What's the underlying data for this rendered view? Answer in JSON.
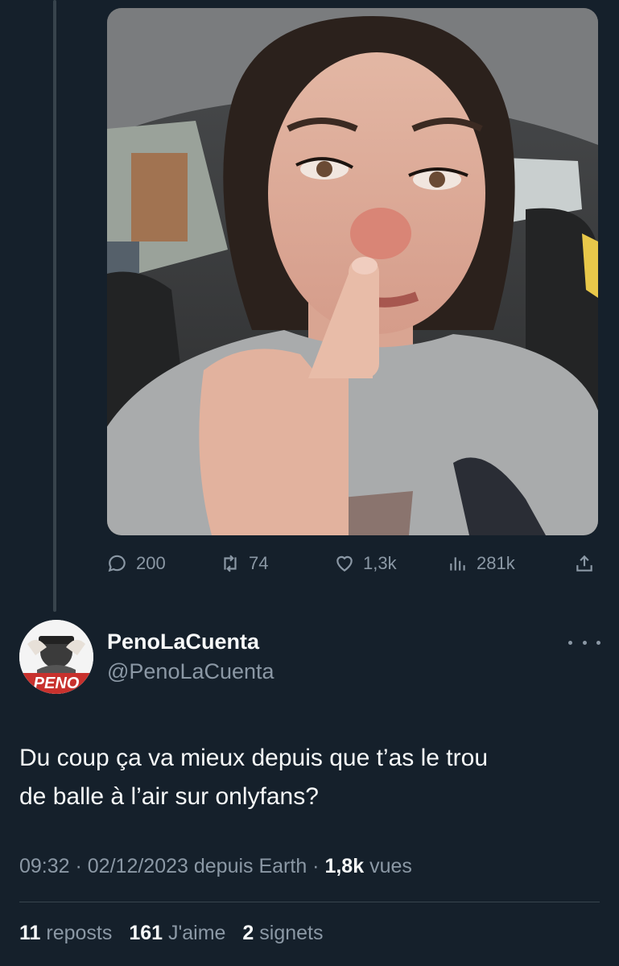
{
  "tweet_actions": {
    "replies": "200",
    "reposts": "74",
    "likes": "1,3k",
    "views": "281k"
  },
  "reply": {
    "display_name": "PenoLaCuenta",
    "handle": "@PenoLaCuenta",
    "avatar_text": "PENO",
    "text_line1": "Du coup ça va mieux depuis que t’as le trou",
    "text_line2": "de balle à l’air sur onlyfans?",
    "time": "09:32",
    "sep1": " · ",
    "date": "02/12/2023",
    "source": " depuis Earth",
    "sep2": " · ",
    "views_count": "1,8k",
    "views_label": " vues",
    "reposts_count": "11",
    "reposts_label": " reposts",
    "likes_count": "161",
    "likes_label": " J'aime",
    "bookmarks_count": "2",
    "bookmarks_label": " signets"
  },
  "icons": {
    "reply": "reply-icon",
    "repost": "repost-icon",
    "like": "heart-icon",
    "views": "views-icon",
    "share": "share-icon",
    "more": "more-icon"
  },
  "colors": {
    "background": "#15202b",
    "primary_text": "#f7f9f9",
    "secondary_text": "#8b98a5",
    "border": "#38444d"
  }
}
